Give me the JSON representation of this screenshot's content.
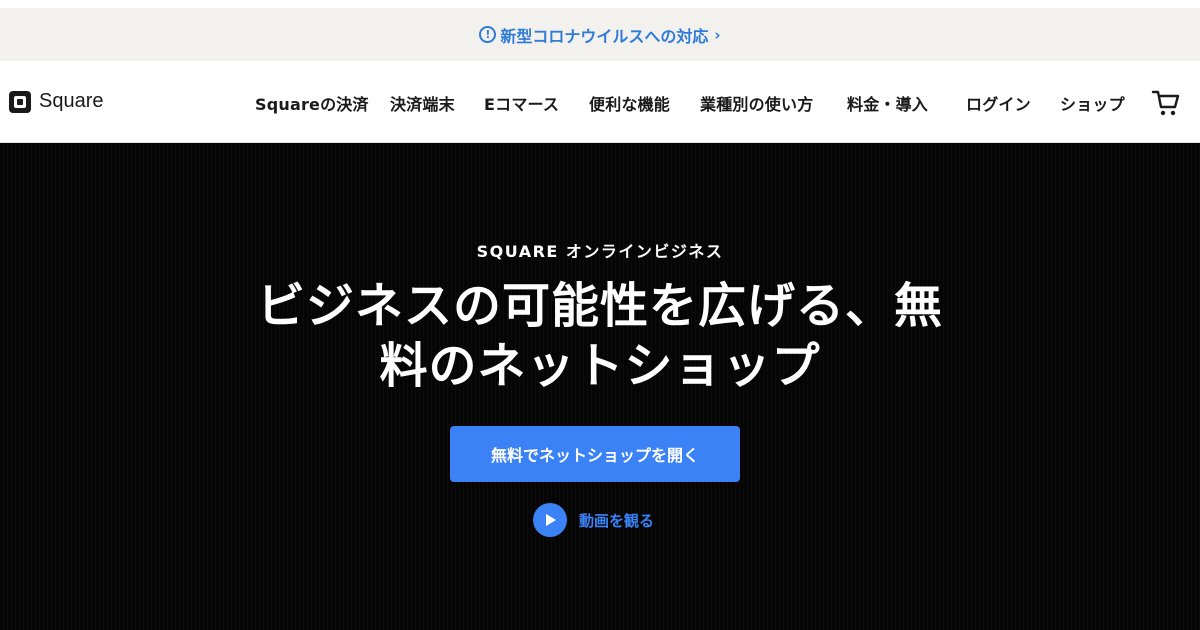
{
  "announcement": {
    "text": "新型コロナウイルスへの対応",
    "info_icon": "!",
    "chevron": "›",
    "color": "#2f7bd8"
  },
  "header": {
    "logo_text": "Square",
    "nav": [
      "Squareの決済",
      "決済端末",
      "Eコマース",
      "便利な機能",
      "業種別の使い方",
      "料金・導入",
      "ログイン",
      "ショップ"
    ],
    "cart_icon": "cart-icon"
  },
  "hero": {
    "eyebrow": "SQUARE オンラインビジネス",
    "headline_line1": "ビジネスの可能性を広げる、無",
    "headline_line2": "料のネットショップ",
    "cta_label": "無料でネットショップを開く",
    "video_label": "動画を観る",
    "accent": "#3b82f6"
  }
}
